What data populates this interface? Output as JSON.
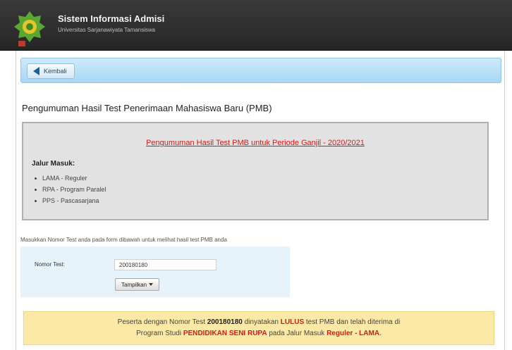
{
  "header": {
    "title": "Sistem Informasi Admisi",
    "subtitle": "Universitas Sarjanawiyata Tamansiswa"
  },
  "toolbar": {
    "back_label": "Kembali"
  },
  "page": {
    "title": "Pengumuman Hasil Test Penerimaan Mahasiswa Baru (PMB)"
  },
  "info": {
    "period_link": "Pengumuman Hasil Test PMB untuk Periode Ganjil - 2020/2021",
    "jalur_title": "Jalur Masuk:",
    "jalur_items": [
      "LAMA - Reguler",
      "RPA - Program Paralel",
      "PPS - Pascasarjana"
    ]
  },
  "form": {
    "instruction": "Masukkan Nomor Test anda pada form dibawah untuk melihat hasil test PMB anda",
    "label": "Nomor Test:",
    "value": "200180180",
    "button_label": "Tampilkan"
  },
  "result": {
    "part1": "Peserta dengan Nomor Test ",
    "nomor": "200180180",
    "part2": " dinyatakan ",
    "status": "LULUS",
    "part3": " test PMB dan telah diterima di",
    "part4": "Program Studi ",
    "prodi": "PENDIDIKAN SENI RUPA",
    "part5": " pada Jalur Masuk ",
    "jalur": "Reguler - LAMA",
    "part6": "."
  },
  "colors": {
    "header_bg": "#2f2f2f",
    "toolbar_bg": "#b3ddf6",
    "info_bg": "#e2e2e2",
    "form_bg": "#e6f3fb",
    "result_bg": "#fde9a6",
    "accent_red": "#d11a1a"
  },
  "icons": {
    "logo": "university-logo-icon",
    "back": "arrow-left-icon",
    "dropdown": "chevron-down-icon"
  }
}
